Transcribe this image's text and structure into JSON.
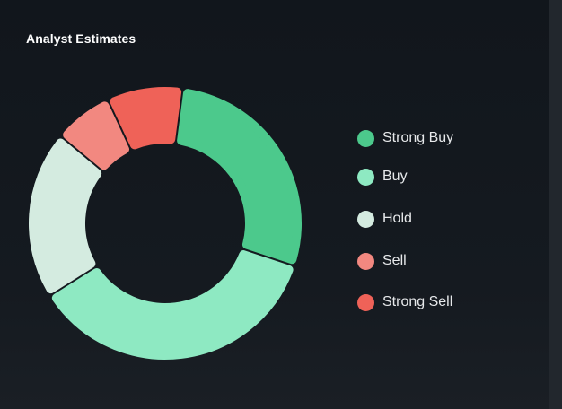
{
  "title": "Analyst Estimates",
  "chart_data": {
    "type": "pie",
    "variant": "donut",
    "title": "Analyst Estimates",
    "legend_position": "right",
    "series": [
      {
        "name": "Strong Buy",
        "value": 28,
        "color": "#4cc98c"
      },
      {
        "name": "Buy",
        "value": 36,
        "color": "#8ee9c2"
      },
      {
        "name": "Hold",
        "value": 20,
        "color": "#d4ebe0"
      },
      {
        "name": "Sell",
        "value": 7,
        "color": "#f28880"
      },
      {
        "name": "Strong Sell",
        "value": 9,
        "color": "#ef6258"
      }
    ]
  }
}
